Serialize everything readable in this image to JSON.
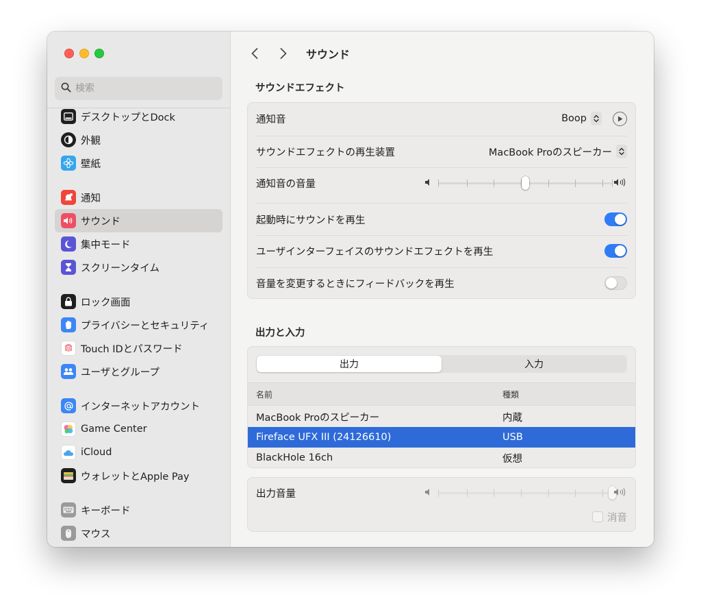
{
  "window": {
    "title": "サウンド"
  },
  "search": {
    "placeholder": "検索"
  },
  "sidebar": {
    "items": [
      {
        "label": "デスクトップとDock",
        "icon": "dock-icon"
      },
      {
        "label": "外観",
        "icon": "appearance-icon"
      },
      {
        "label": "壁紙",
        "icon": "wallpaper-icon"
      },
      {
        "label": "通知",
        "icon": "notifications-icon"
      },
      {
        "label": "サウンド",
        "icon": "sound-icon",
        "selected": true
      },
      {
        "label": "集中モード",
        "icon": "focus-moon-icon"
      },
      {
        "label": "スクリーンタイム",
        "icon": "hourglass-icon"
      },
      {
        "label": "ロック画面",
        "icon": "lock-icon"
      },
      {
        "label": "プライバシーとセキュリティ",
        "icon": "hand-icon"
      },
      {
        "label": "Touch IDとパスワード",
        "icon": "fingerprint-icon"
      },
      {
        "label": "ユーザとグループ",
        "icon": "users-icon"
      },
      {
        "label": "インターネットアカウント",
        "icon": "at-icon"
      },
      {
        "label": "Game Center",
        "icon": "game-center-icon"
      },
      {
        "label": "iCloud",
        "icon": "icloud-icon"
      },
      {
        "label": "ウォレットとApple Pay",
        "icon": "wallet-icon"
      },
      {
        "label": "キーボード",
        "icon": "keyboard-icon"
      },
      {
        "label": "マウス",
        "icon": "mouse-icon"
      }
    ]
  },
  "sound_effects": {
    "section_title": "サウンドエフェクト",
    "alert_sound_label": "通知音",
    "alert_sound_value": "Boop",
    "playback_device_label": "サウンドエフェクトの再生装置",
    "playback_device_value": "MacBook Proのスピーカー",
    "alert_volume_label": "通知音の音量",
    "alert_volume_level": 0.5,
    "startup_sound_label": "起動時にサウンドを再生",
    "startup_sound_on": true,
    "ui_sound_label": "ユーザインターフェイスのサウンドエフェクトを再生",
    "ui_sound_on": true,
    "feedback_label": "音量を変更するときにフィードバックを再生",
    "feedback_on": false
  },
  "output_input": {
    "section_title": "出力と入力",
    "tabs": [
      {
        "label": "出力",
        "active": true
      },
      {
        "label": "入力",
        "active": false
      }
    ],
    "columns": {
      "name": "名前",
      "type": "種類"
    },
    "devices": [
      {
        "name": "MacBook Proのスピーカー",
        "type": "内蔵",
        "selected": false
      },
      {
        "name": "Fireface UFX III (24126610)",
        "type": "USB",
        "selected": true
      },
      {
        "name": "BlackHole 16ch",
        "type": "仮想",
        "selected": false
      }
    ],
    "output_volume_label": "出力音量",
    "output_volume_level": 1.0,
    "mute_label": "消音"
  },
  "colors": {
    "accent": "#2f7cf6",
    "selection": "#2e6bd8"
  }
}
